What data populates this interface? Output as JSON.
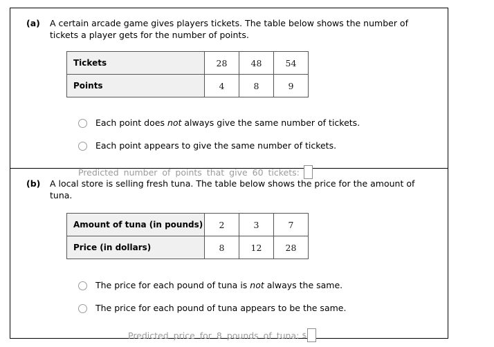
{
  "parts": [
    {
      "label": "(a)",
      "prompt": "A certain arcade game gives players tickets. The table below shows the number of tickets a player gets for the number of points.",
      "table": {
        "rows": [
          {
            "header": "Tickets",
            "values": [
              "28",
              "48",
              "54"
            ]
          },
          {
            "header": "Points",
            "values": [
              "4",
              "8",
              "9"
            ]
          }
        ]
      },
      "choices": [
        {
          "pre": "Each point does ",
          "em": "not",
          "post": " always give the same number of tickets."
        },
        {
          "pre": "Each point appears to give the same number of tickets.",
          "em": "",
          "post": ""
        }
      ],
      "predicted": {
        "text": "Predicted number of points that give 60 tickets:",
        "currency": "",
        "value": ""
      }
    },
    {
      "label": "(b)",
      "prompt": "A local store is selling fresh tuna. The table below shows the price for the amount of tuna.",
      "table": {
        "rows": [
          {
            "header": "Amount of tuna (in pounds)",
            "values": [
              "2",
              "3",
              "7"
            ]
          },
          {
            "header": "Price (in dollars)",
            "values": [
              "8",
              "12",
              "28"
            ]
          }
        ]
      },
      "choices": [
        {
          "pre": "The price for each pound of tuna is ",
          "em": "not",
          "post": " always the same."
        },
        {
          "pre": "The price for each pound of tuna appears to be the same.",
          "em": "",
          "post": ""
        }
      ],
      "predicted": {
        "text": "Predicted price for 8 pounds of tuna:",
        "currency": "$",
        "value": ""
      }
    }
  ],
  "colors": {
    "border": "#000000",
    "table_border": "#555555",
    "header_fill": "#f0f0f0",
    "disabled_text": "#9b9b9b",
    "radio_border": "#9a9a9a"
  }
}
